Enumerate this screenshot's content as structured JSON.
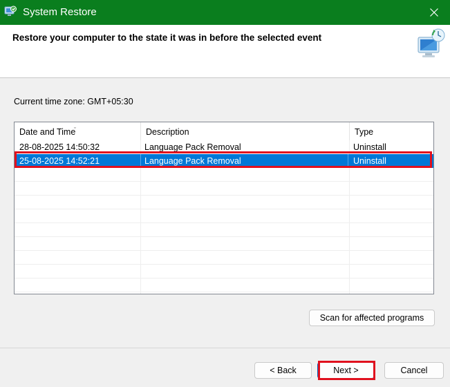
{
  "window": {
    "title": "System Restore",
    "close_glyph": "✕",
    "accent_color": "#0a7e1e"
  },
  "header": {
    "title": "Restore your computer to the state it was in before the selected event",
    "icon": "system-restore-monitor-icon"
  },
  "timezone_label": "Current time zone: GMT+05:30",
  "list": {
    "columns": [
      "Date and Time",
      "Description",
      "Type"
    ],
    "sort_indicator": "ˇ",
    "rows": [
      {
        "date": "28-08-2025 14:50:32",
        "description": "Language Pack Removal",
        "type": "Uninstall",
        "selected": false
      },
      {
        "date": "25-08-2025 14:52:21",
        "description": "Language Pack Removal",
        "type": "Uninstall",
        "selected": true
      }
    ],
    "selection_color": "#0078d7",
    "highlight_color": "#e0101e"
  },
  "buttons": {
    "scan": "Scan for affected programs",
    "back": "< Back",
    "next": "Next >",
    "cancel": "Cancel"
  }
}
